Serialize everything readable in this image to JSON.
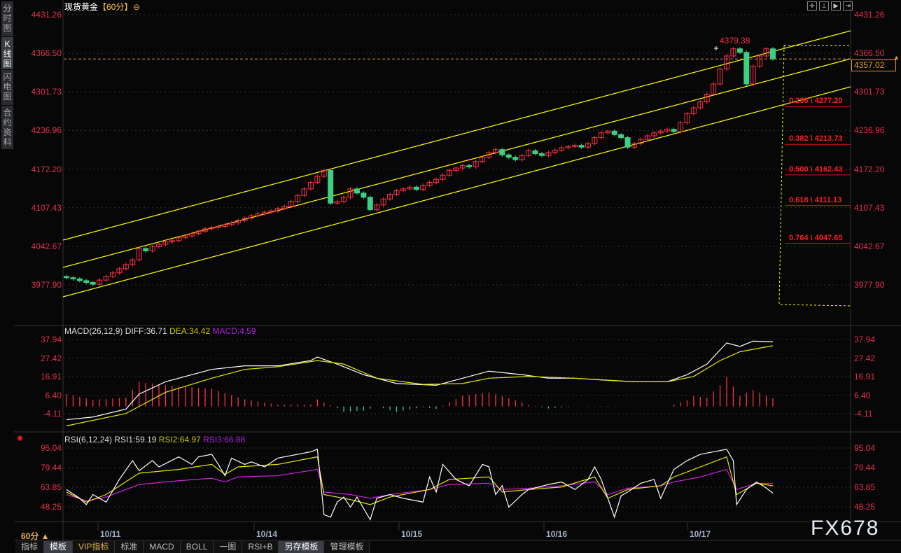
{
  "sidebar": {
    "tabs": [
      {
        "label": "分时图"
      },
      {
        "label": "K线图"
      },
      {
        "label": "闪电图"
      },
      {
        "label": "合约资料"
      }
    ],
    "active": 1
  },
  "header": {
    "symbol": "现货黄金",
    "timeframe": "【60分】",
    "toolbar_icons": [
      "crosshair-icon",
      "zoom-range-icon",
      "play-icon",
      "move-right-icon"
    ]
  },
  "price_axis": {
    "ticks": [
      "4431.26",
      "4366.50",
      "4301.73",
      "4236.96",
      "4172.20",
      "4107.43",
      "4042.67",
      "3977.90"
    ]
  },
  "last_price": "4357.02",
  "high_label": "4379.38",
  "fib_levels": [
    {
      "label": "0.236 \\ 4277.20",
      "price": 4277.2
    },
    {
      "label": "0.382 \\ 4213.73",
      "price": 4213.73
    },
    {
      "label": "0.500 \\ 4162.43",
      "price": 4162.43
    },
    {
      "label": "0.618 \\ 4111.13",
      "price": 4111.13
    },
    {
      "label": "0.764 \\ 4047.65",
      "price": 4047.65
    }
  ],
  "colors": {
    "up": "#ff3048",
    "down": "#3ccf86",
    "channel": "#ffff00",
    "last_price": "#e89a3a",
    "diff": "#ffffff",
    "dea": "#e6e600",
    "rsi3": "#d020e0"
  },
  "chart_data": [
    {
      "type": "candlestick",
      "title": "现货黄金【60分】",
      "ylim": [
        3977.9,
        4431.26
      ],
      "closes": [
        3990,
        3988,
        3985,
        3982,
        3979,
        3986,
        3992,
        3998,
        4005,
        4012,
        4020,
        4039,
        4035,
        4042,
        4046,
        4050,
        4052,
        4057,
        4060,
        4064,
        4068,
        4072,
        4074,
        4076,
        4079,
        4082,
        4086,
        4090,
        4094,
        4097,
        4100,
        4102,
        4106,
        4110,
        4118,
        4128,
        4139,
        4150,
        4160,
        4170,
        4115,
        4118,
        4125,
        4139,
        4132,
        4125,
        4104,
        4112,
        4122,
        4130,
        4136,
        4139,
        4142,
        4138,
        4145,
        4150,
        4155,
        4162,
        4170,
        4174,
        4178,
        4176,
        4185,
        4192,
        4200,
        4205,
        4196,
        4192,
        4188,
        4195,
        4203,
        4198,
        4195,
        4200,
        4204,
        4208,
        4210,
        4212,
        4209,
        4215,
        4225,
        4233,
        4236,
        4230,
        4225,
        4209,
        4215,
        4222,
        4228,
        4233,
        4236,
        4239,
        4235,
        4250,
        4265,
        4275,
        4285,
        4298,
        4315,
        4340,
        4362,
        4374,
        4368,
        4315,
        4345,
        4362,
        4374,
        4357
      ],
      "x_ticks": [
        "10/11",
        "10/14",
        "10/15",
        "10/16",
        "10/17"
      ]
    },
    {
      "type": "line",
      "title": "MACD(26,12,9)",
      "legend": {
        "diff": "DIFF:36.71",
        "dea": "DEA:34.42",
        "macd": "MACD:4.59"
      },
      "y_ticks": [
        "37.94",
        "27.42",
        "16.91",
        "6.40",
        "-4.11"
      ],
      "diff": [
        [
          0,
          -7.5
        ],
        [
          4,
          -6
        ],
        [
          9,
          -1.5
        ],
        [
          11,
          7
        ],
        [
          15,
          14
        ],
        [
          22,
          21
        ],
        [
          27,
          23
        ],
        [
          32,
          23
        ],
        [
          37,
          26
        ],
        [
          38,
          28
        ],
        [
          41,
          24
        ],
        [
          45,
          18
        ],
        [
          50,
          13
        ],
        [
          56,
          12
        ],
        [
          60,
          16
        ],
        [
          64,
          20
        ],
        [
          69,
          18
        ],
        [
          73,
          16
        ],
        [
          77,
          16
        ],
        [
          81,
          15
        ],
        [
          86,
          14
        ],
        [
          91,
          14
        ],
        [
          94,
          18
        ],
        [
          97,
          24
        ],
        [
          100,
          36
        ],
        [
          102,
          34
        ],
        [
          104,
          37
        ],
        [
          107,
          36.71
        ]
      ],
      "dea": [
        [
          0,
          -11
        ],
        [
          9,
          -4
        ],
        [
          15,
          8
        ],
        [
          22,
          16
        ],
        [
          27,
          21
        ],
        [
          32,
          22.5
        ],
        [
          38,
          26
        ],
        [
          42,
          24
        ],
        [
          47,
          16
        ],
        [
          54,
          12.5
        ],
        [
          60,
          13
        ],
        [
          64,
          16
        ],
        [
          70,
          17
        ],
        [
          77,
          16
        ],
        [
          86,
          14
        ],
        [
          91,
          14
        ],
        [
          95,
          17
        ],
        [
          99,
          26
        ],
        [
          102,
          31
        ],
        [
          107,
          34.42
        ]
      ]
    },
    {
      "type": "line",
      "title": "RSI(6,12,24)",
      "legend": {
        "rsi1": "RSI1:59.19",
        "rsi2": "RSI2:64.97",
        "rsi3": "RSI3:66.88"
      },
      "y_ticks": [
        "95.04",
        "79.44",
        "63.85",
        "48.25"
      ],
      "rsi1": [
        [
          0,
          62
        ],
        [
          2,
          55
        ],
        [
          3,
          50
        ],
        [
          4,
          58
        ],
        [
          6,
          52
        ],
        [
          8,
          70
        ],
        [
          10,
          85
        ],
        [
          11,
          77
        ],
        [
          13,
          85
        ],
        [
          14,
          80
        ],
        [
          17,
          88
        ],
        [
          19,
          82
        ],
        [
          20,
          88
        ],
        [
          22,
          90
        ],
        [
          23,
          82
        ],
        [
          24,
          73
        ],
        [
          25,
          87
        ],
        [
          27,
          82
        ],
        [
          28,
          84
        ],
        [
          30,
          80
        ],
        [
          32,
          87
        ],
        [
          35,
          90
        ],
        [
          37,
          92
        ],
        [
          38,
          94
        ],
        [
          39,
          42
        ],
        [
          40,
          40
        ],
        [
          41,
          52
        ],
        [
          42,
          56
        ],
        [
          43,
          48
        ],
        [
          44,
          56
        ],
        [
          46,
          38
        ],
        [
          47,
          55
        ],
        [
          49,
          58
        ],
        [
          51,
          55
        ],
        [
          54,
          52
        ],
        [
          55,
          72
        ],
        [
          56,
          60
        ],
        [
          57,
          82
        ],
        [
          59,
          70
        ],
        [
          61,
          65
        ],
        [
          63,
          82
        ],
        [
          64,
          80
        ],
        [
          65,
          58
        ],
        [
          66,
          65
        ],
        [
          67,
          48
        ],
        [
          69,
          58
        ],
        [
          70,
          62
        ],
        [
          73,
          66
        ],
        [
          75,
          68
        ],
        [
          77,
          62
        ],
        [
          79,
          70
        ],
        [
          80,
          80
        ],
        [
          81,
          70
        ],
        [
          82,
          55
        ],
        [
          83,
          40
        ],
        [
          84,
          57
        ],
        [
          85,
          60
        ],
        [
          87,
          67
        ],
        [
          89,
          70
        ],
        [
          90,
          55
        ],
        [
          92,
          78
        ],
        [
          94,
          85
        ],
        [
          96,
          90
        ],
        [
          98,
          92
        ],
        [
          100,
          94
        ],
        [
          101,
          85
        ],
        [
          101.5,
          50
        ],
        [
          103,
          62
        ],
        [
          104.5,
          68
        ],
        [
          105.5,
          65
        ],
        [
          107,
          59.19
        ]
      ],
      "rsi2": [
        [
          0,
          60
        ],
        [
          3,
          52
        ],
        [
          6,
          58
        ],
        [
          11,
          75
        ],
        [
          17,
          78
        ],
        [
          22,
          82
        ],
        [
          24,
          74
        ],
        [
          26,
          80
        ],
        [
          32,
          82
        ],
        [
          38,
          88
        ],
        [
          39,
          58
        ],
        [
          43,
          54
        ],
        [
          46,
          50
        ],
        [
          49,
          56
        ],
        [
          55,
          62
        ],
        [
          58,
          70
        ],
        [
          64,
          72
        ],
        [
          66,
          60
        ],
        [
          70,
          62
        ],
        [
          75,
          64
        ],
        [
          80,
          72
        ],
        [
          82,
          55
        ],
        [
          85,
          62
        ],
        [
          90,
          65
        ],
        [
          92,
          72
        ],
        [
          96,
          80
        ],
        [
          100,
          88
        ],
        [
          101.5,
          58
        ],
        [
          104.5,
          67
        ],
        [
          107,
          64.97
        ]
      ],
      "rsi3": [
        [
          0,
          58
        ],
        [
          3,
          53
        ],
        [
          6,
          56
        ],
        [
          11,
          66
        ],
        [
          17,
          69
        ],
        [
          22,
          71
        ],
        [
          24,
          68
        ],
        [
          26,
          72
        ],
        [
          32,
          73
        ],
        [
          38,
          78
        ],
        [
          39,
          60
        ],
        [
          43,
          58
        ],
        [
          46,
          55
        ],
        [
          49,
          58
        ],
        [
          55,
          62
        ],
        [
          58,
          66
        ],
        [
          64,
          67
        ],
        [
          66,
          62
        ],
        [
          70,
          63
        ],
        [
          75,
          65
        ],
        [
          80,
          68
        ],
        [
          82,
          58
        ],
        [
          85,
          63
        ],
        [
          90,
          65
        ],
        [
          92,
          68
        ],
        [
          96,
          72
        ],
        [
          100,
          78
        ],
        [
          101.5,
          62
        ],
        [
          104.5,
          67
        ],
        [
          107,
          66.88
        ]
      ]
    }
  ],
  "period_label": "60分 ▲",
  "bottom_tabs": [
    "指标",
    "模板",
    "VIP指标",
    "标准",
    "MACD",
    "BOLL",
    "一图",
    "RSI+B",
    "另存模板",
    "管理模板"
  ],
  "watermark": "FX678"
}
